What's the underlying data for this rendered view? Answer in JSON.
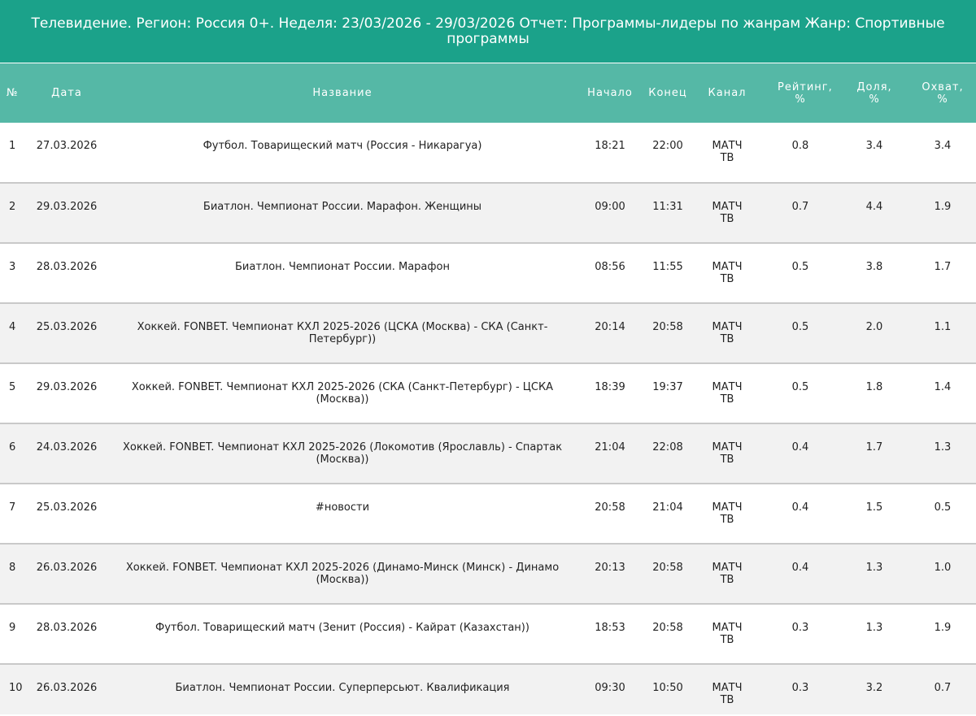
{
  "report": {
    "title": "Телевидение. Регион: Россия 0+. Неделя: 23/03/2026 - 29/03/2026 Отчет: Программы-лидеры по жанрам Жанр: Спортивные программы"
  },
  "columns": {
    "no": "№",
    "date": "Дата",
    "name": "Название",
    "start": "Начало",
    "end": "Конец",
    "channel": "Канал",
    "rating": "Рейтинг, %",
    "share": "Доля, %",
    "reach": "Охват, %"
  },
  "rows": [
    {
      "no": "1",
      "date": "27.03.2026",
      "name": "Футбол. Товарищеский матч (Россия - Никарагуа)",
      "start": "18:21",
      "end": "22:00",
      "channel": "МАТЧ ТВ",
      "rating": "0.8",
      "share": "3.4",
      "reach": "3.4"
    },
    {
      "no": "2",
      "date": "29.03.2026",
      "name": "Биатлон. Чемпионат России. Марафон. Женщины",
      "start": "09:00",
      "end": "11:31",
      "channel": "МАТЧ ТВ",
      "rating": "0.7",
      "share": "4.4",
      "reach": "1.9"
    },
    {
      "no": "3",
      "date": "28.03.2026",
      "name": "Биатлон. Чемпионат России. Марафон",
      "start": "08:56",
      "end": "11:55",
      "channel": "МАТЧ ТВ",
      "rating": "0.5",
      "share": "3.8",
      "reach": "1.7"
    },
    {
      "no": "4",
      "date": "25.03.2026",
      "name": "Хоккей. FONBET. Чемпионат КХЛ 2025-2026 (ЦСКА (Москва) - СКА (Санкт-Петербург))",
      "start": "20:14",
      "end": "20:58",
      "channel": "МАТЧ ТВ",
      "rating": "0.5",
      "share": "2.0",
      "reach": "1.1"
    },
    {
      "no": "5",
      "date": "29.03.2026",
      "name": "Хоккей. FONBET. Чемпионат КХЛ 2025-2026 (СКА (Санкт-Петербург) - ЦСКА (Москва))",
      "start": "18:39",
      "end": "19:37",
      "channel": "МАТЧ ТВ",
      "rating": "0.5",
      "share": "1.8",
      "reach": "1.4"
    },
    {
      "no": "6",
      "date": "24.03.2026",
      "name": "Хоккей. FONBET. Чемпионат КХЛ 2025-2026 (Локомотив (Ярославль) - Спартак (Москва))",
      "start": "21:04",
      "end": "22:08",
      "channel": "МАТЧ ТВ",
      "rating": "0.4",
      "share": "1.7",
      "reach": "1.3"
    },
    {
      "no": "7",
      "date": "25.03.2026",
      "name": "#новости",
      "start": "20:58",
      "end": "21:04",
      "channel": "МАТЧ ТВ",
      "rating": "0.4",
      "share": "1.5",
      "reach": "0.5"
    },
    {
      "no": "8",
      "date": "26.03.2026",
      "name": "Хоккей. FONBET. Чемпионат КХЛ 2025-2026 (Динамо-Минск (Минск) - Динамо (Москва))",
      "start": "20:13",
      "end": "20:58",
      "channel": "МАТЧ ТВ",
      "rating": "0.4",
      "share": "1.3",
      "reach": "1.0"
    },
    {
      "no": "9",
      "date": "28.03.2026",
      "name": "Футбол. Товарищеский матч (Зенит (Россия) - Кайрат (Казахстан))",
      "start": "18:53",
      "end": "20:58",
      "channel": "МАТЧ ТВ",
      "rating": "0.3",
      "share": "1.3",
      "reach": "1.9"
    },
    {
      "no": "10",
      "date": "26.03.2026",
      "name": "Биатлон. Чемпионат России. Суперперсьют. Квалификация",
      "start": "09:30",
      "end": "10:50",
      "channel": "МАТЧ ТВ",
      "rating": "0.3",
      "share": "3.2",
      "reach": "0.7"
    }
  ]
}
